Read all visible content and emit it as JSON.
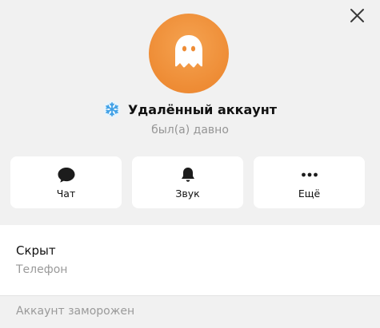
{
  "header": {
    "close_icon": "close-icon"
  },
  "profile": {
    "avatar_icon": "ghost-icon",
    "avatar_color": "#EE8C35",
    "badge_icon": "snowflake-icon",
    "badge_color": "#3FA0E6",
    "name": "Удалённый аккаунт",
    "status": "был(а) давно"
  },
  "actions": [
    {
      "icon": "chat-bubble-icon",
      "label": "Чат"
    },
    {
      "icon": "bell-icon",
      "label": "Звук"
    },
    {
      "icon": "more-dots-icon",
      "label": "Ещё"
    }
  ],
  "info": {
    "phone_value": "Скрыт",
    "phone_label": "Телефон"
  },
  "footer": {
    "note": "Аккаунт заморожен"
  }
}
